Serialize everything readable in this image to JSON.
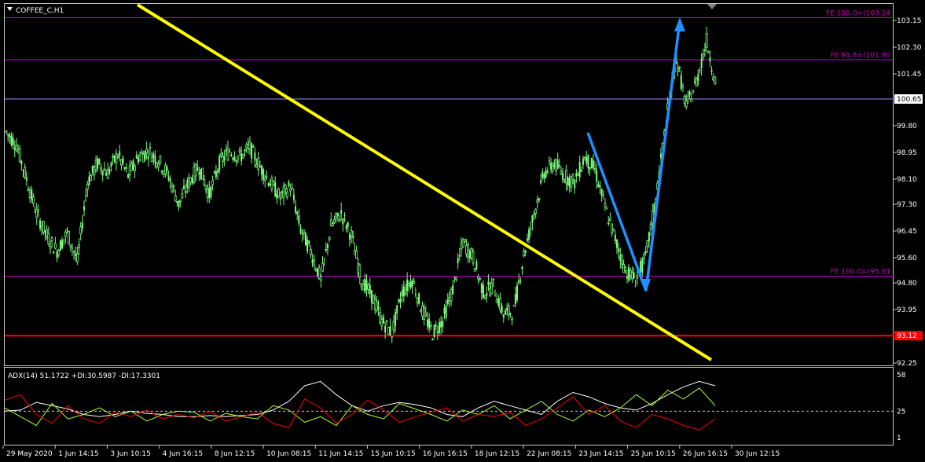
{
  "symbol_title": "COFFEE_C,H1",
  "colors": {
    "background": "#000000",
    "frame": "#c8c8c8",
    "bull": "#7cfc7c",
    "fib": "#c800c8",
    "trend": "#ffff00",
    "wave": "#1e90ff",
    "support": "#ff0000",
    "adx_main": "#ffffff",
    "plus_di": "#adff2f",
    "minus_di": "#ff0000"
  },
  "price_axis": {
    "ticks": [
      "103.15",
      "102.30",
      "101.45",
      "99.80",
      "98.95",
      "98.10",
      "97.30",
      "96.45",
      "95.60",
      "94.80",
      "93.95",
      "92.25"
    ],
    "ylim": [
      92.25,
      103.24
    ],
    "current_price": "100.65",
    "support_price": "93.12"
  },
  "time_axis": {
    "labels": [
      "29 May 2020",
      "1 Jun 14:15",
      "3 Jun 10:15",
      "4 Jun 16:15",
      "8 Jun 12:15",
      "10 Jun 08:15",
      "11 Jun 14:15",
      "15 Jun 10:15",
      "16 Jun 16:15",
      "18 Jun 12:15",
      "22 Jun 08:15",
      "23 Jun 14:15",
      "25 Jun 10:15",
      "26 Jun 16:15",
      "30 Jun 12:15"
    ]
  },
  "fib_levels": [
    {
      "label": "FE 100.0=(103.24",
      "price": 103.24
    },
    {
      "label": "FE 61.8=(101.90",
      "price": 101.9
    },
    {
      "label": "FE 100.0=(95.01",
      "price": 95.01
    }
  ],
  "adx": {
    "label": "ADX(14) 51.1722 +DI:30.5987 -DI:17.3301",
    "ticks": [
      "58",
      "25",
      "1"
    ],
    "ylim": [
      1,
      58
    ]
  },
  "chart_data": {
    "type": "line",
    "title": "COFFEE_C,H1",
    "xlabel": "",
    "ylabel": "",
    "series": [
      {
        "name": "close",
        "values": [
          99.6,
          99.2,
          98.1,
          97.0,
          96.3,
          95.8,
          96.4,
          95.5,
          98.0,
          98.6,
          98.3,
          98.9,
          98.2,
          98.8,
          99.0,
          98.7,
          98.2,
          97.3,
          98.0,
          98.5,
          97.6,
          98.6,
          99.0,
          98.8,
          99.1,
          98.5,
          98.0,
          97.5,
          97.9,
          96.5,
          95.8,
          94.9,
          96.6,
          97.0,
          96.3,
          94.9,
          94.4,
          93.6,
          93.2,
          94.5,
          94.9,
          93.9,
          93.2,
          93.6,
          94.6,
          96.1,
          95.6,
          94.5,
          94.7,
          93.8,
          93.9,
          95.7,
          97.0,
          98.3,
          98.6,
          98.2,
          98.0,
          98.8,
          98.4,
          97.2,
          96.2,
          95.2,
          94.9,
          95.6,
          97.5,
          99.9,
          102.0,
          100.4,
          101.2,
          102.5,
          101.0
        ]
      }
    ],
    "adx_series": [
      {
        "name": "ADX",
        "values": [
          25,
          26,
          33,
          30,
          27,
          22,
          20,
          22,
          25,
          23,
          22,
          20,
          20,
          21,
          20,
          21,
          22,
          26,
          34,
          48,
          52,
          40,
          30,
          25,
          30,
          33,
          31,
          28,
          22,
          20,
          28,
          34,
          30,
          26,
          22,
          34,
          42,
          38,
          32,
          28,
          26,
          32,
          40,
          47,
          52,
          48
        ]
      },
      {
        "name": "+DI",
        "values": [
          28,
          20,
          12,
          32,
          18,
          22,
          28,
          20,
          25,
          16,
          22,
          25,
          24,
          16,
          23,
          20,
          18,
          30,
          26,
          15,
          20,
          12,
          30,
          22,
          18,
          32,
          27,
          22,
          16,
          26,
          22,
          30,
          18,
          26,
          34,
          22,
          16,
          26,
          20,
          28,
          40,
          30,
          44,
          36,
          46,
          30
        ]
      },
      {
        "name": "-DI",
        "values": [
          35,
          40,
          22,
          14,
          30,
          18,
          14,
          24,
          20,
          26,
          18,
          22,
          19,
          25,
          16,
          20,
          24,
          14,
          10,
          36,
          28,
          14,
          22,
          35,
          26,
          15,
          20,
          24,
          28,
          16,
          22,
          20,
          24,
          12,
          18,
          28,
          38,
          22,
          30,
          16,
          10,
          22,
          18,
          12,
          8,
          18
        ]
      }
    ],
    "ylim": [
      92.25,
      103.24
    ]
  }
}
